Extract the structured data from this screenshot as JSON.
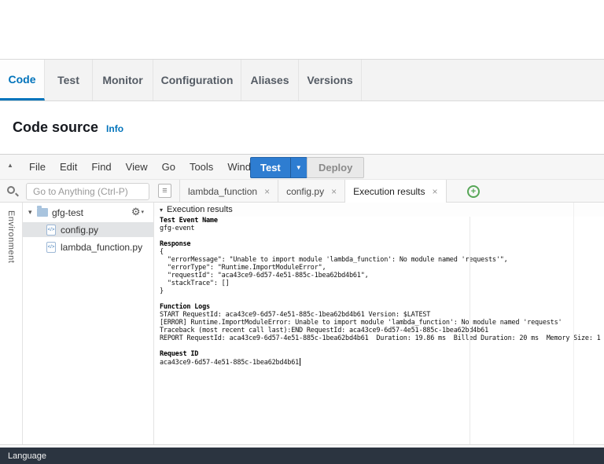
{
  "colors": {
    "accent_blue": "#0073bb",
    "test_button_blue": "#2e7dd1",
    "status_bar_bg": "#2b3440",
    "plus_green": "#56a656"
  },
  "glyphs": {
    "collapse_up": "▲",
    "disclosure_down": "▾",
    "dropdown_caret": "▼",
    "gear": "⚙",
    "close": "×",
    "plus": "+",
    "menu_lines": "≡",
    "results_caret": "▾"
  },
  "function_tabs": {
    "items": [
      "Code",
      "Test",
      "Monitor",
      "Configuration",
      "Aliases",
      "Versions"
    ]
  },
  "header": {
    "title": "Code source",
    "info_link": "Info"
  },
  "menu_bar": {
    "items": [
      "File",
      "Edit",
      "Find",
      "View",
      "Go",
      "Tools",
      "Window"
    ],
    "test_button_label": "Test",
    "deploy_button_label": "Deploy"
  },
  "quick_open": {
    "placeholder": "Go to Anything (Ctrl-P)"
  },
  "left_rail": {
    "environment_label": "Environment"
  },
  "file_tree": {
    "folder_name": "gfg-test",
    "files": [
      "config.py",
      "lambda_function.py"
    ]
  },
  "editor_tabs": {
    "tabs": [
      "lambda_function",
      "config.py",
      "Execution results"
    ]
  },
  "results": {
    "section_header": "Execution results",
    "test_event_name_label": "Test Event Name",
    "test_event_name_value": "gfg-event",
    "response_label": "Response",
    "response_lines": [
      "{",
      "  \"errorMessage\": \"Unable to import module 'lambda_function': No module named 'requests'\",",
      "  \"errorType\": \"Runtime.ImportModuleError\",",
      "  \"requestId\": \"aca43ce9-6d57-4e51-885c-1bea62bd4b61\",",
      "  \"stackTrace\": []",
      "}"
    ],
    "function_logs_label": "Function Logs",
    "log_lines": [
      "START RequestId: aca43ce9-6d57-4e51-885c-1bea62bd4b61 Version: $LATEST",
      "[ERROR] Runtime.ImportModuleError: Unable to import module 'lambda_function': No module named 'requests'",
      "Traceback (most recent call last):END RequestId: aca43ce9-6d57-4e51-885c-1bea62bd4b61",
      "REPORT RequestId: aca43ce9-6d57-4e51-885c-1bea62bd4b61  Duration: 19.86 ms  Billed Duration: 20 ms  Memory Size: 1"
    ],
    "request_id_label": "Request ID",
    "request_id_value": "aca43ce9-6d57-4e51-885c-1bea62bd4b61"
  },
  "status_bar": {
    "language_label": "Language"
  }
}
